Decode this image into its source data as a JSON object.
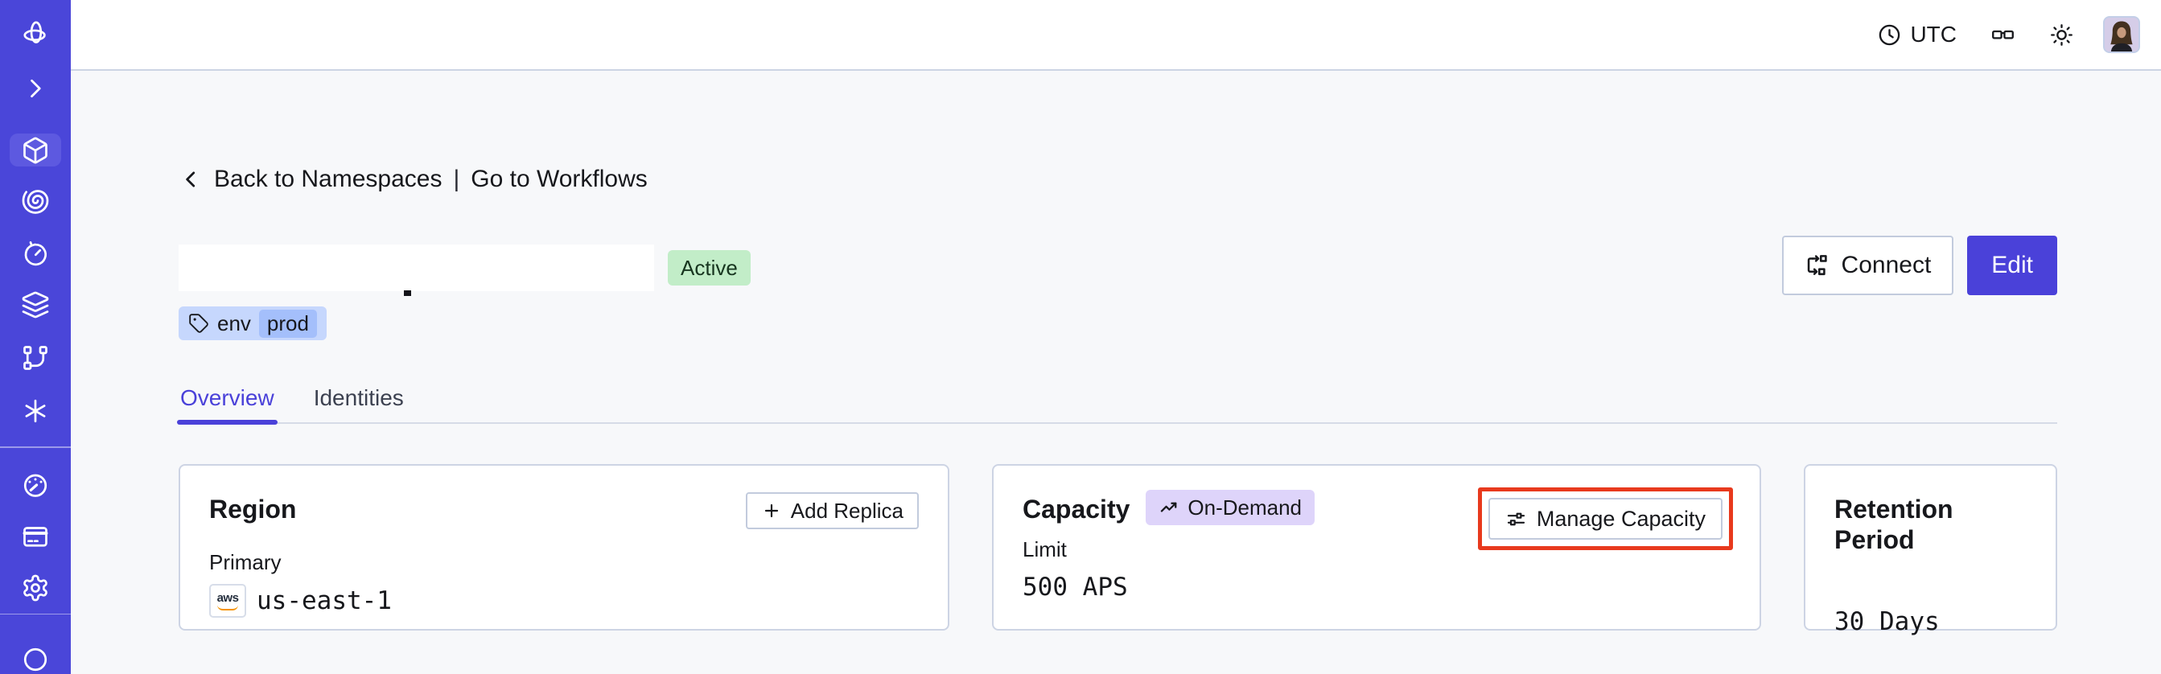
{
  "topbar": {
    "timezone": "UTC",
    "icons": [
      "clock-icon",
      "glasses-icon",
      "sun-icon",
      "avatar"
    ]
  },
  "sidebar": {
    "items": [
      "temporal-logo",
      "expand-chevron",
      "namespaces",
      "workflows",
      "schedules",
      "batch-operations",
      "deployments",
      "nexus",
      "usage",
      "billing",
      "settings",
      "account"
    ],
    "active_item": "namespaces"
  },
  "breadcrumb": {
    "back": "Back to Namespaces",
    "separator": "|",
    "workflows": "Go to Workflows"
  },
  "header": {
    "status": "Active",
    "tag": {
      "key": "env",
      "value": "prod"
    },
    "connect": "Connect",
    "edit": "Edit"
  },
  "tabs": [
    {
      "label": "Overview",
      "active": true
    },
    {
      "label": "Identities",
      "active": false
    }
  ],
  "cards": {
    "region": {
      "title": "Region",
      "add_replica": "Add Replica",
      "primary_label": "Primary",
      "provider": "aws",
      "value": "us-east-1"
    },
    "capacity": {
      "title": "Capacity",
      "badge": "On-Demand",
      "manage": "Manage Capacity",
      "limit_label": "Limit",
      "value": "500 APS"
    },
    "retention": {
      "title": "Retention Period",
      "value": "30 Days"
    }
  },
  "colors": {
    "sidebar_bg": "#4a46d9",
    "accent": "#4a41d9",
    "annotation_red": "#e8391d",
    "active_badge_bg": "#c2edc8",
    "tag_bg": "#c6d7fd",
    "tag_value_bg": "#a4bffb",
    "ondemand_bg": "#ded4fa",
    "card_border": "#cdd4e4",
    "content_bg": "#f7f8fa"
  }
}
